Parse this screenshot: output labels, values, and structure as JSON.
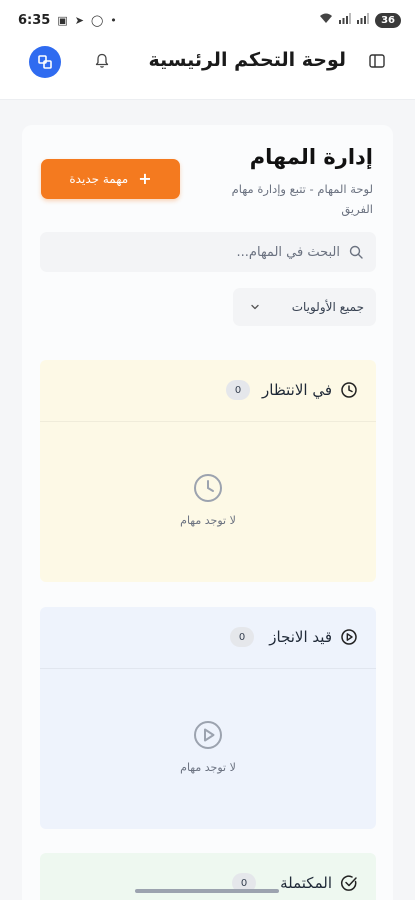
{
  "status_bar": {
    "time": "6:35",
    "battery": "36"
  },
  "header": {
    "title": "لوحة التحكم الرئيسية",
    "avatar_icon": "app-logo-icon",
    "bell_icon": "bell-icon",
    "sidebar_icon": "sidebar-toggle-icon"
  },
  "page": {
    "title": "إدارة المهام",
    "subtitle": "لوحة المهام - تتبع وإدارة مهام الفريق",
    "new_task_label": "مهمة جديدة",
    "new_task_icon": "plus-icon"
  },
  "search": {
    "placeholder": "البحث في المهام...",
    "value": ""
  },
  "filter": {
    "priority_selected": "جميع الأولويات"
  },
  "columns": [
    {
      "title": "في الانتظار",
      "count": "0",
      "empty_text": "لا توجد مهام",
      "icon": "clock-icon",
      "color": "#fdf9e6"
    },
    {
      "title": "قيد الانجاز",
      "count": "0",
      "empty_text": "لا توجد مهام",
      "icon": "play-circle-icon",
      "color": "#eef3fc"
    },
    {
      "title": "المكتملة",
      "count": "0",
      "icon": "check-circle-icon",
      "color": "#eef8f0"
    }
  ],
  "colors": {
    "accent": "#f47a1f",
    "brand": "#2f6bf0"
  }
}
